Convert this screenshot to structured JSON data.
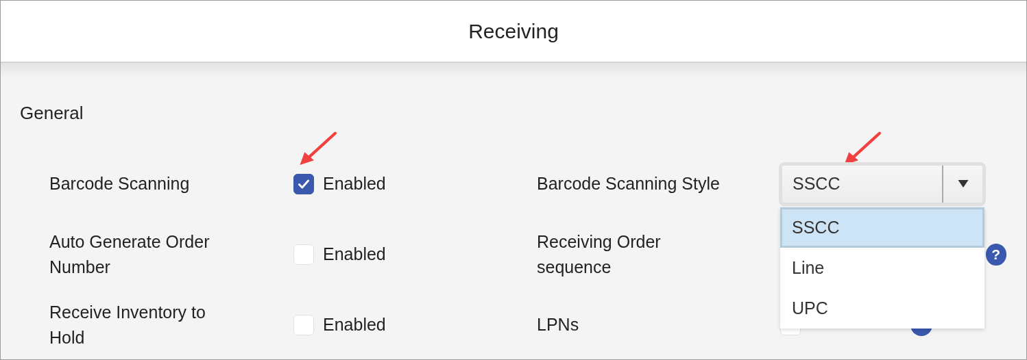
{
  "window": {
    "title": "Receiving"
  },
  "section": {
    "title": "General"
  },
  "rows": [
    {
      "left": {
        "label": "Barcode Scanning",
        "kind": "checkbox",
        "checked": true,
        "text": "Enabled",
        "highlighted": true
      },
      "right": {
        "label": "Barcode Scanning Style",
        "kind": "select",
        "value": "SSCC",
        "expanded": true,
        "highlighted": true,
        "options": [
          {
            "label": "SSCC",
            "selected": true
          },
          {
            "label": "Line",
            "selected": false
          },
          {
            "label": "UPC",
            "selected": false
          }
        ]
      }
    },
    {
      "left": {
        "label": "Auto Generate Order Number",
        "kind": "checkbox",
        "checked": false,
        "text": "Enabled"
      },
      "right": {
        "label": "Receiving Order sequence",
        "kind": "hidden",
        "help": "?"
      }
    },
    {
      "left": {
        "label": "Receive Inventory to Hold",
        "kind": "checkbox",
        "checked": false,
        "text": "Enabled"
      },
      "right": {
        "label": "LPNs",
        "kind": "checkbox",
        "checked": false,
        "help_icon": true
      }
    }
  ]
}
